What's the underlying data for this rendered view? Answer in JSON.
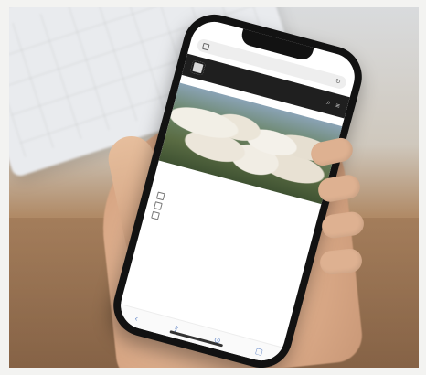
{
  "scene": {
    "description_icons": [
      "keyboard",
      "hand",
      "phone"
    ]
  },
  "phone": {
    "status": {
      "time": "",
      "signal": ""
    },
    "browser": {
      "url": ""
    },
    "site": {
      "logo_text": ""
    },
    "breadcrumb": "",
    "article": {
      "title": "",
      "text": ""
    },
    "links": [
      {
        "label": ""
      },
      {
        "label": ""
      },
      {
        "label": ""
      }
    ],
    "toolbar_icons": [
      "back-icon",
      "share-icon",
      "bookmarks-icon",
      "tabs-icon"
    ]
  }
}
